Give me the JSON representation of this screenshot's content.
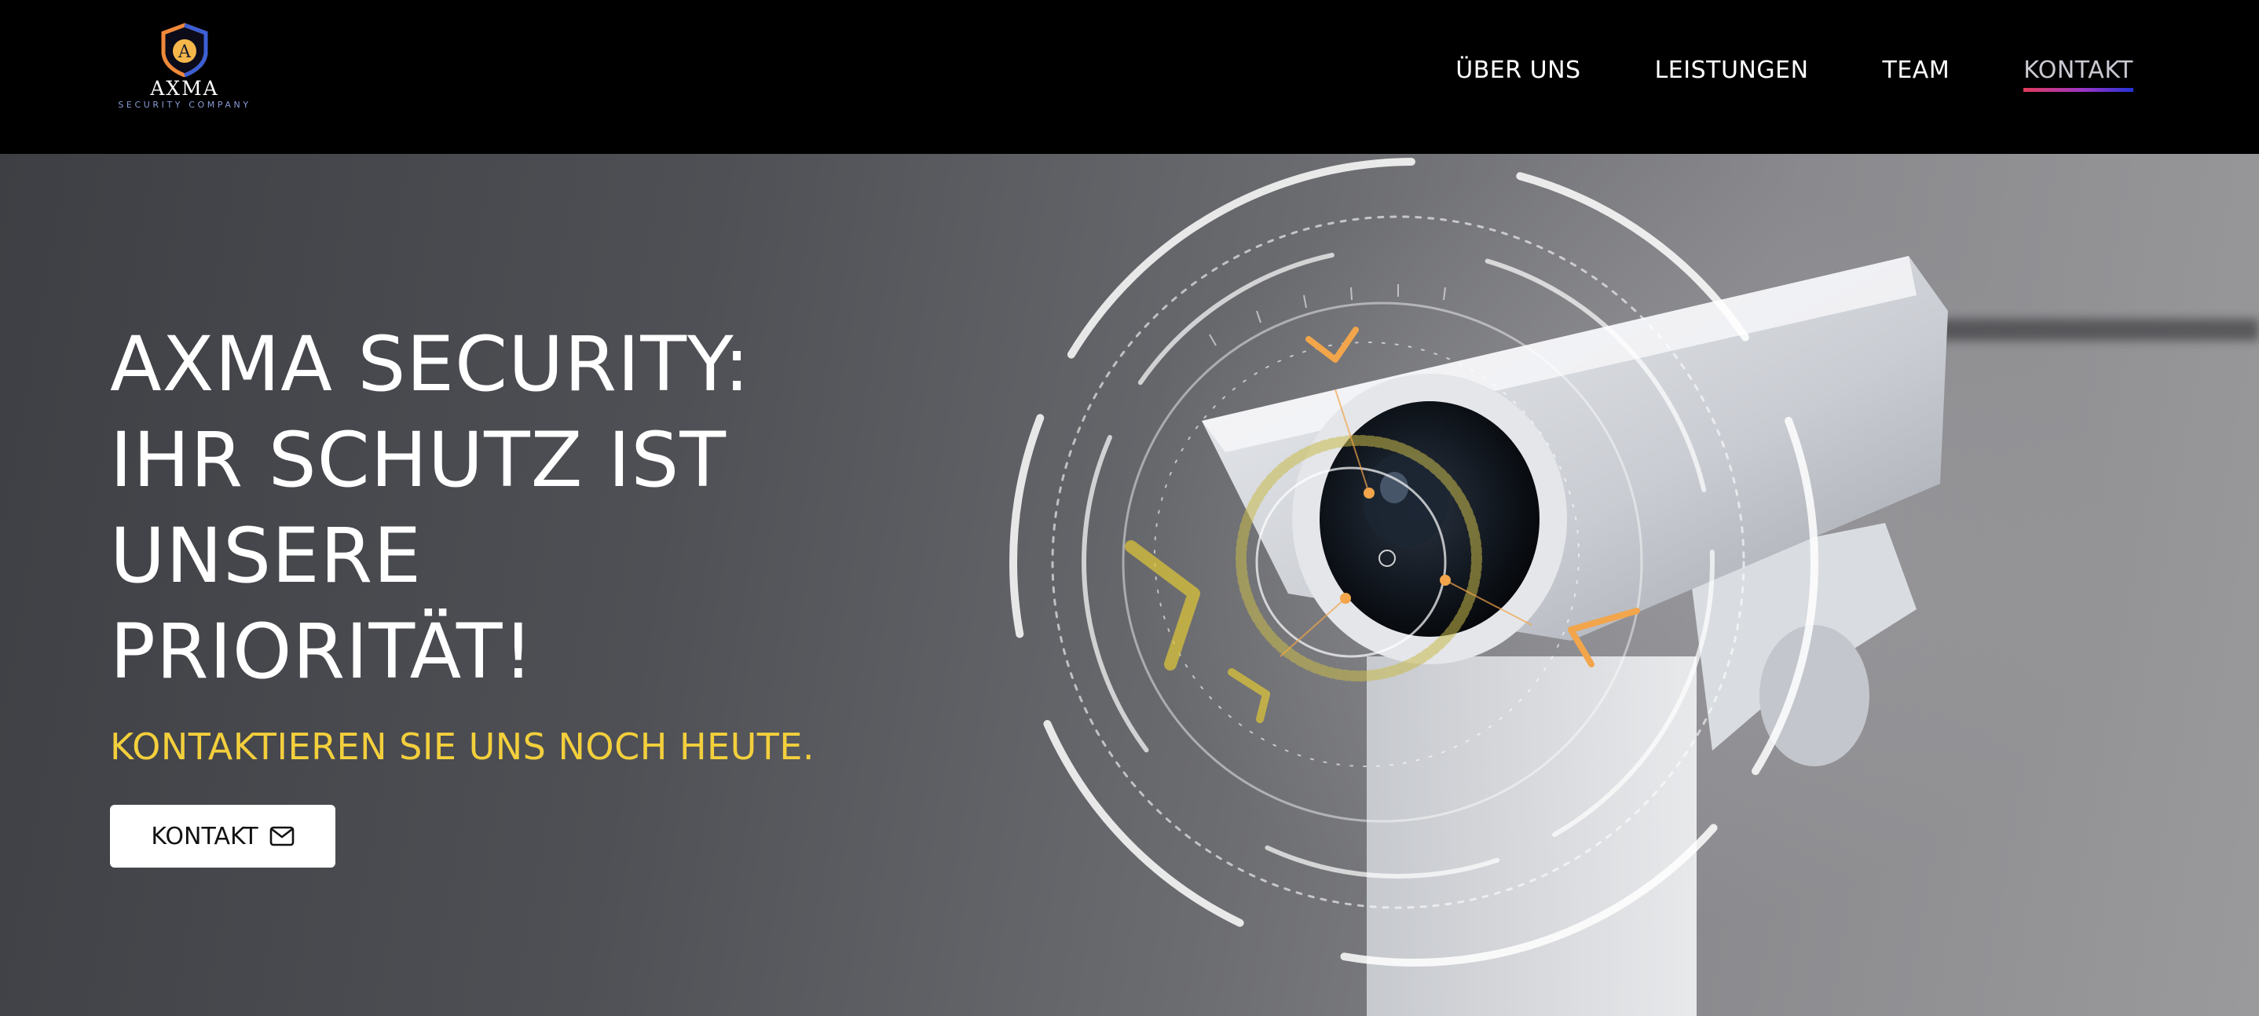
{
  "brand": {
    "name": "AXMA",
    "tagline": "SECURITY COMPANY",
    "logo_letter": "A",
    "logo_icon": "shield-icon"
  },
  "nav": {
    "items": [
      {
        "label": "ÜBER UNS",
        "active": false
      },
      {
        "label": "LEISTUNGEN",
        "active": false
      },
      {
        "label": "TEAM",
        "active": false
      },
      {
        "label": "KONTAKT",
        "active": true
      }
    ]
  },
  "hero": {
    "title_lines": [
      "AXMA SECURITY:",
      "IHR SCHUTZ IST",
      "UNSERE",
      "PRIORITÄT!"
    ],
    "subtitle": "KONTAKTIEREN SIE UNS NOCH HEUTE.",
    "cta": {
      "label": "KONTAKT",
      "icon": "mail-icon"
    },
    "image": "security-camera-hud"
  },
  "colors": {
    "header_bg": "#000000",
    "accent_yellow": "#f3cf3c",
    "nav_underline": [
      "#e23b5a",
      "#9b35c7",
      "#2433d8"
    ],
    "logo_orange": "#f0883a",
    "logo_blue": "#3b5fd6"
  }
}
